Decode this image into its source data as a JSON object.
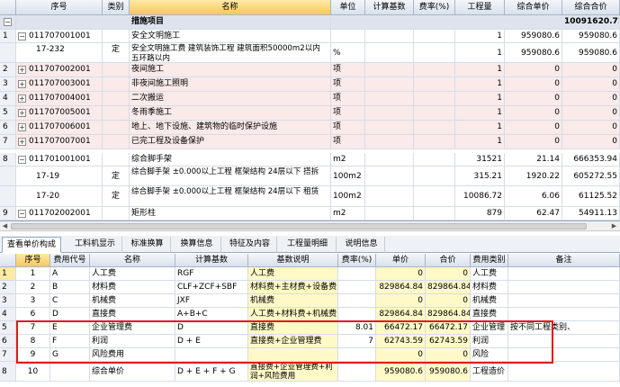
{
  "top_grid": {
    "headers": [
      "序号",
      "类别",
      "名称",
      "单位",
      "计算基数",
      "费率(%)",
      "工程量",
      "综合单价",
      "综合合价"
    ],
    "group_row": {
      "expander": "−",
      "name": "措施项目",
      "total": "10091620.71"
    },
    "rows": [
      {
        "num": "1",
        "expander": "−",
        "code": "011707001001",
        "category": "",
        "name": "安全文明施工",
        "unit": "",
        "base": "",
        "rate": "",
        "qty": "1",
        "unit_price": "959080.6",
        "total": "959080.6"
      },
      {
        "num": "",
        "expander": "",
        "code": "17-232",
        "category": "定",
        "name": "安全文明施工费 建筑装饰工程 建筑面积50000m2以内 五环路以内",
        "unit": "%",
        "base": "",
        "rate": "",
        "qty": "1",
        "unit_price": "959080.6",
        "total": "959080.6"
      },
      {
        "num": "2",
        "expander": "+",
        "code": "011707002001",
        "category": "",
        "name": "夜间施工",
        "unit": "项",
        "base": "",
        "rate": "",
        "qty": "1",
        "unit_price": "0",
        "total": "0"
      },
      {
        "num": "3",
        "expander": "+",
        "code": "011707003001",
        "category": "",
        "name": "非夜间施工照明",
        "unit": "项",
        "base": "",
        "rate": "",
        "qty": "1",
        "unit_price": "0",
        "total": "0"
      },
      {
        "num": "4",
        "expander": "+",
        "code": "011707004001",
        "category": "",
        "name": "二次搬运",
        "unit": "项",
        "base": "",
        "rate": "",
        "qty": "1",
        "unit_price": "0",
        "total": "0"
      },
      {
        "num": "5",
        "expander": "+",
        "code": "011707005001",
        "category": "",
        "name": "冬雨季施工",
        "unit": "项",
        "base": "",
        "rate": "",
        "qty": "1",
        "unit_price": "0",
        "total": "0"
      },
      {
        "num": "6",
        "expander": "+",
        "code": "011707006001",
        "category": "",
        "name": "地上、地下设施、建筑物的临时保护设施",
        "unit": "项",
        "base": "",
        "rate": "",
        "qty": "1",
        "unit_price": "0",
        "total": "0"
      },
      {
        "num": "7",
        "expander": "+",
        "code": "011707007001",
        "category": "",
        "name": "已完工程及设备保护",
        "unit": "项",
        "base": "",
        "rate": "",
        "qty": "1",
        "unit_price": "0",
        "total": "0"
      },
      {
        "num": "8",
        "expander": "−",
        "code": "011701001001",
        "category": "",
        "name": "综合脚手架",
        "unit": "m2",
        "base": "",
        "rate": "",
        "qty": "31521",
        "unit_price": "21.14",
        "total": "666353.94"
      },
      {
        "num": "",
        "expander": "",
        "code": "17-19",
        "category": "定",
        "name": "综合脚手架 ±0.000以上工程 框架结构 24层以下 搭拆",
        "unit": "100m2",
        "base": "",
        "rate": "",
        "qty": "315.21",
        "unit_price": "1920.22",
        "total": "605272.55"
      },
      {
        "num": "",
        "expander": "",
        "code": "17-20",
        "category": "定",
        "name": "综合脚手架 ±0.000以上工程 框架结构 24层以下 租赁",
        "unit": "100m2",
        "base": "",
        "rate": "",
        "qty": "10086.72",
        "unit_price": "6.06",
        "total": "61125.52"
      },
      {
        "num": "9",
        "expander": "−",
        "code": "011702002001",
        "category": "",
        "name": "矩形柱",
        "unit": "m2",
        "base": "",
        "rate": "",
        "qty": "879",
        "unit_price": "62.47",
        "total": "54911.13"
      }
    ]
  },
  "tabs": [
    "查看单价构成",
    "工料机显示",
    "标准换算",
    "换算信息",
    "特征及内容",
    "工程量明细",
    "说明信息"
  ],
  "bottom_grid": {
    "headers": [
      "序号",
      "费用代号",
      "名称",
      "计算基数",
      "基数说明",
      "费率(%)",
      "单价",
      "合价",
      "费用类别",
      "备注"
    ],
    "rows": [
      {
        "idx": "1",
        "seq": "1",
        "code": "A",
        "name": "人工费",
        "base": "RGF",
        "desc": "人工费",
        "rate": "",
        "price": "0",
        "total": "0",
        "type": "人工费",
        "note": ""
      },
      {
        "idx": "2",
        "seq": "2",
        "code": "B",
        "name": "材料费",
        "base": "CLF+ZCF+SBF",
        "desc": "材料费+主材费+设备费",
        "rate": "",
        "price": "829864.84",
        "total": "829864.84",
        "type": "材料费",
        "note": ""
      },
      {
        "idx": "3",
        "seq": "3",
        "code": "C",
        "name": "机械费",
        "base": "JXF",
        "desc": "机械费",
        "rate": "",
        "price": "0",
        "total": "0",
        "type": "机械费",
        "note": ""
      },
      {
        "idx": "4",
        "seq": "6",
        "code": "D",
        "name": "直接费",
        "base": "A+B+C",
        "desc": "人工费+材料费+机械费",
        "rate": "",
        "price": "829864.84",
        "total": "829864.84",
        "type": "直接费",
        "note": ""
      },
      {
        "idx": "5",
        "seq": "7",
        "code": "E",
        "name": "企业管理费",
        "base": "D",
        "desc": "直接费",
        "rate": "8.01",
        "price": "66472.17",
        "total": "66472.17",
        "type": "企业管理",
        "note": "按不同工程类别、"
      },
      {
        "idx": "6",
        "seq": "8",
        "code": "F",
        "name": "利润",
        "base": "D + E",
        "desc": "直接费+企业管理费",
        "rate": "7",
        "price": "62743.59",
        "total": "62743.59",
        "type": "利润",
        "note": ""
      },
      {
        "idx": "7",
        "seq": "9",
        "code": "G",
        "name": "风险费用",
        "base": "",
        "desc": "",
        "rate": "",
        "price": "0",
        "total": "0",
        "type": "风险",
        "note": ""
      },
      {
        "idx": "8",
        "seq": "10",
        "code": "",
        "name": "综合单价",
        "base": "D + E + F + G",
        "desc": "直接费+企业管理费+利润+风险费用",
        "rate": "",
        "price": "959080.6",
        "total": "959080.6",
        "type": "工程造价",
        "note": ""
      }
    ]
  },
  "colors": {
    "highlight_box": "#e0191a",
    "header_selected": "#f5c95a",
    "yellow_cell": "#fff9c8",
    "pink_row": "#fbeaea"
  }
}
